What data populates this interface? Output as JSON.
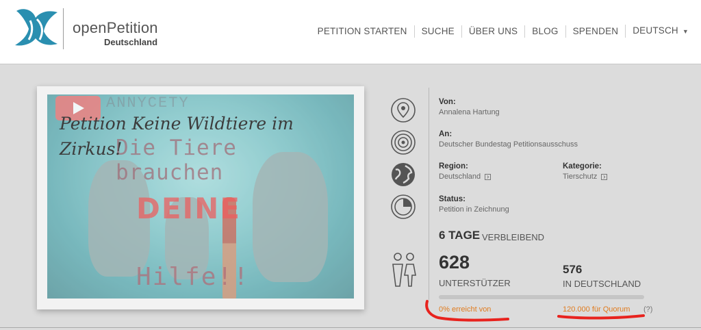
{
  "brand": {
    "name": "openPetition",
    "sub": "Deutschland",
    "logo_icon": "dove-logo-icon",
    "accent": "#2a8fb0"
  },
  "nav": {
    "items": [
      {
        "label": "PETITION STARTEN"
      },
      {
        "label": "SUCHE"
      },
      {
        "label": "ÜBER UNS"
      },
      {
        "label": "BLOG"
      },
      {
        "label": "SPENDEN"
      },
      {
        "label": "DEUTSCH"
      }
    ]
  },
  "video": {
    "watermark": "ANNYCETY",
    "title": "Petition Keine Wildtiere im Zirkus!",
    "line2": "Die Tiere brauchen",
    "line3": "DEINE",
    "line4": "Hilfe!!",
    "play_icon": "play-icon"
  },
  "info": {
    "von_label": "Von:",
    "von_value": "Annalena Hartung",
    "an_label": "An:",
    "an_value": "Deutscher Bundestag Petitionsausschuss",
    "region_label": "Region:",
    "region_value": "Deutschland",
    "kategorie_label": "Kategorie:",
    "kategorie_value": "Tierschutz",
    "status_label": "Status:",
    "status_value": "Petition in Zeichnung"
  },
  "stats": {
    "days_num": "6 TAGE",
    "days_text": "VERBLEIBEND",
    "supporters": "628",
    "supporters_label": "UNTERSTÜTZER",
    "germany": "576",
    "germany_label": "IN DEUTSCHLAND",
    "progress_percent": 0,
    "reach_text": "0% erreicht von",
    "quorum_text": "120.000  für Quorum",
    "help_text": "(?)",
    "highlight_color": "#e07b1e",
    "annotation_color": "#e8231e"
  }
}
